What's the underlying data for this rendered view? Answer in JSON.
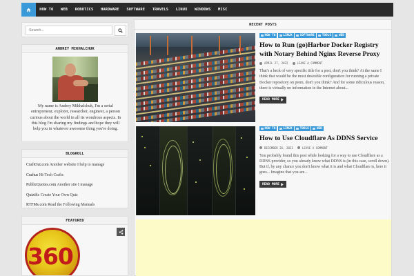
{
  "nav": {
    "items": [
      "",
      "HOW TO",
      "WEB",
      "ROBOTICS",
      "HARDWARE",
      "SOFTWARE",
      "TRAVELS",
      "LINUX",
      "WINDOWS",
      "MISC"
    ],
    "active_index": 0,
    "active_color": "#3a9ad9"
  },
  "search": {
    "placeholder": "Search...",
    "icon": "search-icon"
  },
  "author": {
    "title": "ANDREY MIKHALCHUK",
    "bio": "My name is Andrey Mikhalchuk, I'm a serial entrepreneur, explorer, researcher, engineer, a person curious about the world in all its wondrous aspects. In this blog I'm sharing my findings and hope they will help you in whatever awesome thing you're doing."
  },
  "blogroll": {
    "title": "BLOGROLL",
    "items": [
      {
        "site": "CraftOut.com",
        "desc": " Another website I help to manage"
      },
      {
        "site": "Craftus",
        "desc": " Hi-Tech Crafts"
      },
      {
        "site": "PublicQuotes.com",
        "desc": " Another site I manage"
      },
      {
        "site": "Quizific",
        "desc": " Create Your Own Quiz"
      },
      {
        "site": "RTFMs.com",
        "desc": " Read the Following Manuals"
      }
    ]
  },
  "featured": {
    "title": "FEATURED",
    "logo_text": "360",
    "share_icon": "share-icon"
  },
  "main": {
    "title": "RECENT POSTS",
    "posts": [
      {
        "tags": [
          "HOW TO",
          "LINUX",
          "SOFTWARE",
          "TOOLS",
          "WEB"
        ],
        "title": "How to Run (go)Harbor Docker Registry with Notary Behind Nginx Reverse Proxy",
        "date": "APRIL 27, 2022",
        "comment": "LEAVE A COMMENT",
        "excerpt": "That's a heck of very specific title for a post, don't you think? At the same I think that would be the most desirable configuration for running a private Docker repository on prem, don't you think? And for some ridiculous reason, there is virtually no information in the Internet about...",
        "read_more": "READ MORE"
      },
      {
        "tags": [
          "HOW TO",
          "LINUX",
          "TOOLS",
          "WEB"
        ],
        "title": "How to Use Cloudflare As DDNS Service",
        "date": "DECEMBER 26, 2021",
        "comment": "LEAVE A COMMENT",
        "excerpt": "You probably found this post while looking for a way to use Cloudflare as a DDNS provider, so you already know what DDNS is (in this case, scroll down). But if, by any chance you don't know what it is and what Cloudflare is, here it goes... Imagine that you are...",
        "read_more": "READ MORE"
      }
    ]
  }
}
